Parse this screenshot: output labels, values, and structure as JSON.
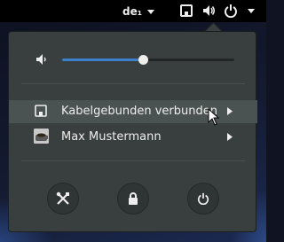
{
  "topbar": {
    "keyboard_layout": "de₁",
    "icons": [
      "network-wired-icon",
      "volume-icon",
      "power-icon",
      "chevron-down-icon"
    ]
  },
  "menu": {
    "volume": {
      "level": 0.47,
      "icon": "volume-low-icon"
    },
    "network": {
      "label": "Kabelgebunden verbunden",
      "icon": "network-wired-icon"
    },
    "user": {
      "label": "Max Mustermann",
      "icon": "avatar"
    },
    "actions": [
      "settings-icon",
      "lock-icon",
      "power-icon"
    ]
  },
  "colors": {
    "accent": "#3b80c8",
    "menu_bg": "#393f3f",
    "highlight": "#4a5252",
    "topbar": "#000000"
  }
}
